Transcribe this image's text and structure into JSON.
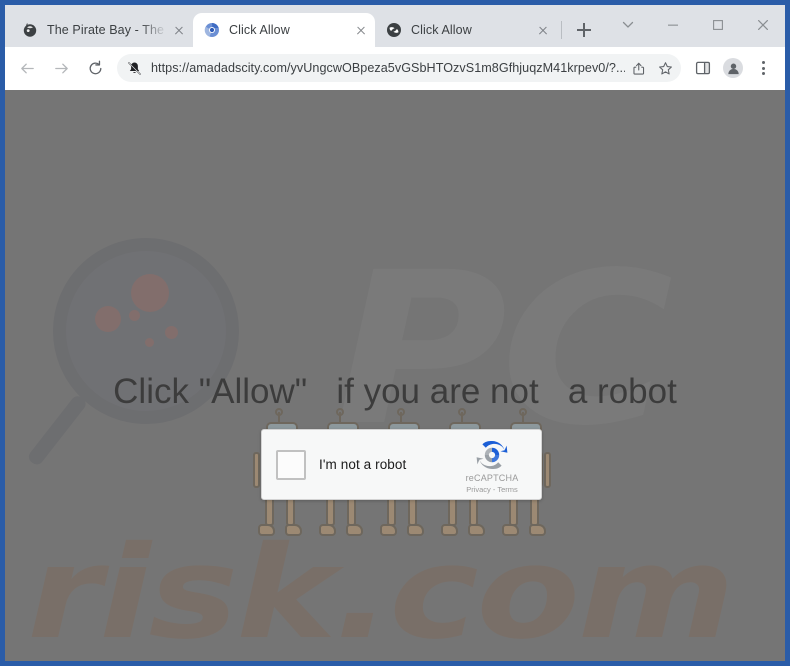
{
  "browser": {
    "tabs": [
      {
        "title": "The Pirate Bay - The ga",
        "favicon": "pirate-bay-favicon",
        "active": false
      },
      {
        "title": "Click Allow",
        "favicon": "chrome-swirl-favicon",
        "active": true
      },
      {
        "title": "Click Allow",
        "favicon": "dark-globe-favicon",
        "active": false
      }
    ],
    "new_tab_label": "+",
    "window_controls": {
      "tab_search": "tab-search",
      "minimize": "minimize",
      "maximize": "maximize",
      "close": "close"
    },
    "toolbar": {
      "back": "back",
      "forward": "forward",
      "reload": "reload",
      "notifications_blocked": "notifications-blocked",
      "url": "https://amadadscity.com/yvUngcwOBpeza5vGSbHTOzvS1m8GfhjuqzM41krpev0/?...",
      "share": "share",
      "bookmark": "bookmark-star",
      "side_panel": "side-panel",
      "profile": "profile-avatar",
      "menu": "chrome-menu"
    }
  },
  "page": {
    "headline": "Click \"Allow\"   if you are not   a robot",
    "recaptcha": {
      "checkbox_label": "I'm not a robot",
      "brand": "reCAPTCHA",
      "terms": "Privacy - Terms"
    },
    "watermark": {
      "letters": "PC",
      "domain": "risk.com"
    },
    "robot_count": 5,
    "colors": {
      "page_background": "#7d7d7d",
      "window_border": "#2a5ca8",
      "tabstrip": "#dee1e6",
      "omnibox": "#f1f3f4",
      "recaptcha_blue": "#1c5fd6",
      "recaptcha_grey": "#9aa0a6",
      "watermark_orange": "#8a6a52"
    }
  }
}
